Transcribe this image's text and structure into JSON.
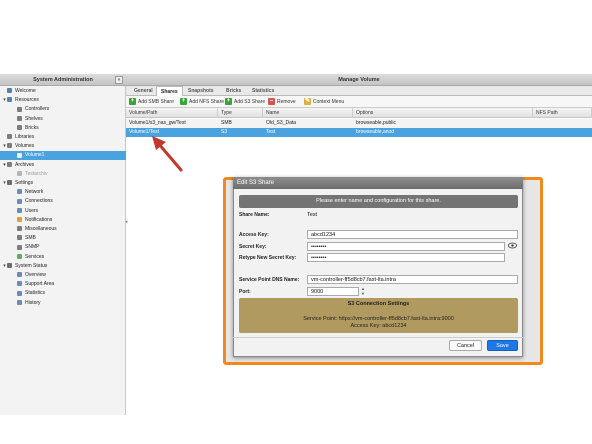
{
  "left_panel": {
    "title": "System Administration",
    "collapse": "«",
    "items": [
      {
        "label": "Welcome",
        "indent": 0,
        "toggle": "",
        "color": "#5a7fb0",
        "state": ""
      },
      {
        "label": "Resources",
        "indent": 0,
        "toggle": "▾",
        "color": "#5a7fb0",
        "state": ""
      },
      {
        "label": "Controllers",
        "indent": 1,
        "toggle": "",
        "color": "#7d7d7d",
        "state": ""
      },
      {
        "label": "Shelves",
        "indent": 1,
        "toggle": "",
        "color": "#7d7d7d",
        "state": ""
      },
      {
        "label": "Bricks",
        "indent": 1,
        "toggle": "",
        "color": "#7d7d7d",
        "state": ""
      },
      {
        "label": "Libraries",
        "indent": 0,
        "toggle": "",
        "color": "#7d7d7d",
        "state": ""
      },
      {
        "label": "Volumes",
        "indent": 0,
        "toggle": "▾",
        "color": "#7d7d7d",
        "state": ""
      },
      {
        "label": "Volume1",
        "indent": 1,
        "toggle": "",
        "color": "#e8f3fb",
        "state": "selected"
      },
      {
        "label": "Archives",
        "indent": 0,
        "toggle": "▾",
        "color": "#7d7d7d",
        "state": ""
      },
      {
        "label": "Testarchiv",
        "indent": 1,
        "toggle": "",
        "color": "#b5b5b5",
        "state": "disabled"
      },
      {
        "label": "Settings",
        "indent": 0,
        "toggle": "▾",
        "color": "#6d6d6d",
        "state": ""
      },
      {
        "label": "Network",
        "indent": 1,
        "toggle": "",
        "color": "#6d8cb5",
        "state": ""
      },
      {
        "label": "Connections",
        "indent": 1,
        "toggle": "",
        "color": "#6d8cb5",
        "state": ""
      },
      {
        "label": "Users",
        "indent": 1,
        "toggle": "",
        "color": "#6d8cb5",
        "state": ""
      },
      {
        "label": "Notifications",
        "indent": 1,
        "toggle": "",
        "color": "#d9a33a",
        "state": ""
      },
      {
        "label": "Miscellaneous",
        "indent": 1,
        "toggle": "",
        "color": "#7d7d7d",
        "state": ""
      },
      {
        "label": "SMB",
        "indent": 1,
        "toggle": "",
        "color": "#7d7d7d",
        "state": ""
      },
      {
        "label": "SNMP",
        "indent": 1,
        "toggle": "",
        "color": "#7d7d7d",
        "state": ""
      },
      {
        "label": "Services",
        "indent": 1,
        "toggle": "",
        "color": "#6aa86a",
        "state": ""
      },
      {
        "label": "System Status",
        "indent": 0,
        "toggle": "▾",
        "color": "#6d6d6d",
        "state": ""
      },
      {
        "label": "Overview",
        "indent": 1,
        "toggle": "",
        "color": "#6d8cb5",
        "state": ""
      },
      {
        "label": "Support Area",
        "indent": 1,
        "toggle": "",
        "color": "#6d8cb5",
        "state": ""
      },
      {
        "label": "Statistics",
        "indent": 1,
        "toggle": "",
        "color": "#6d8cb5",
        "state": ""
      },
      {
        "label": "History",
        "indent": 1,
        "toggle": "",
        "color": "#6d8cb5",
        "state": ""
      }
    ]
  },
  "main": {
    "title": "Manage Volume",
    "tabs": [
      "General",
      "Shares",
      "Snapshots",
      "Bricks",
      "Statistics"
    ],
    "active_tab": "Shares",
    "toolbar": [
      {
        "label": "Add SMB Share",
        "icon": "+",
        "color": "#3aa33a"
      },
      {
        "label": "Add NFS Share",
        "icon": "+",
        "color": "#3aa33a"
      },
      {
        "label": "Add S3 Share",
        "icon": "+",
        "color": "#3aa33a"
      },
      {
        "label": "Remove",
        "icon": "–",
        "color": "#d9534f"
      },
      {
        "label": "Context Menu",
        "icon": "✎",
        "color": "#e0b040"
      }
    ],
    "columns": [
      "Volume/Path",
      "Type",
      "Name",
      "Options",
      "NFS Path"
    ],
    "rows": [
      [
        "Volume1/s3_nas_gw/Test",
        "SMB",
        "Old_S3_Data",
        "browseable,public",
        ""
      ],
      [
        "Volume1/Test",
        "S3",
        "Test",
        "browseable,anod",
        ""
      ]
    ],
    "selected_row": 1,
    "splitter": "◂"
  },
  "dialog": {
    "title": "Edit S3 Share",
    "banner": "Please enter name and configuration for this share.",
    "share_name_label": "Share Name:",
    "share_name_value": "Test",
    "access_key_label": "Access Key:",
    "access_key_value": "abcd1234",
    "secret_key_label": "Secret Key:",
    "secret_key_value": "••••••••",
    "retype_label": "Retype New Secret Key:",
    "retype_value": "••••••••",
    "dns_label": "Service Point DNS Name:",
    "dns_value": "vm-controller-ff5d8cb7.fast-lta.intra",
    "port_label": "Port:",
    "port_value": "9000",
    "s3_title": "S3 Connection Settings",
    "s3_line1": "Service Point:  https://vm-controller-ff5d8cb7.fast-lta.intra:9000",
    "s3_line2": "Access Key:  abcd1234",
    "cancel_label": "Cancel",
    "save_label": "Save",
    "highlight_color": "#f08a1c"
  },
  "annotation": {
    "arrow_color": "#c0392b"
  }
}
